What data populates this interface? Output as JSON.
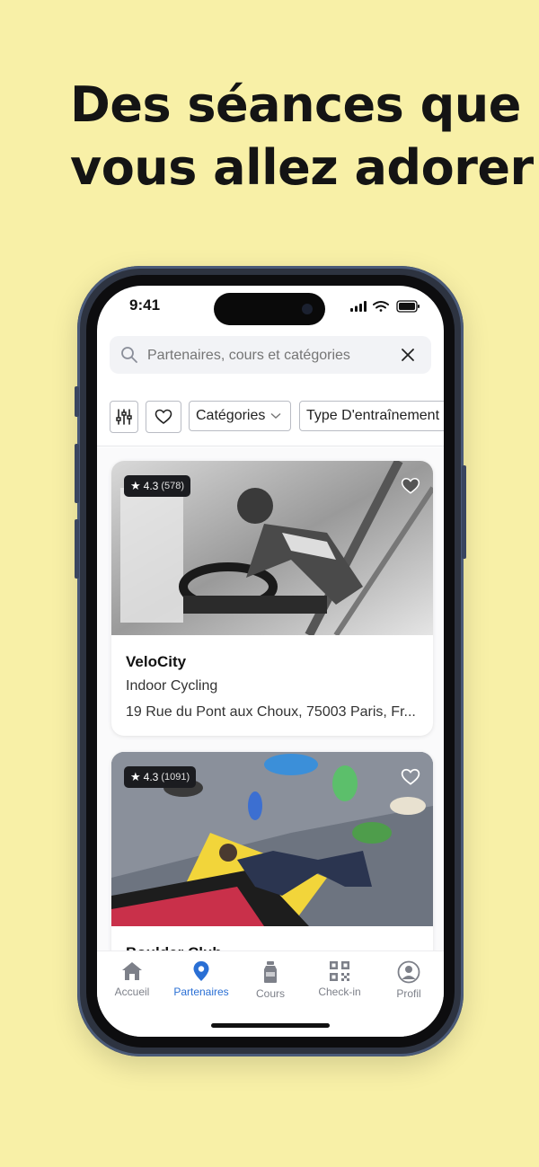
{
  "headline": {
    "line1": "Des séances que",
    "line2": "vous allez adorer"
  },
  "status": {
    "time": "9:41"
  },
  "search": {
    "placeholder": "Partenaires, cours et catégories"
  },
  "filters": {
    "categories": "Catégories",
    "training_type": "Type D'entraînement"
  },
  "cards": [
    {
      "rating": "4.3",
      "count": "(578)",
      "title": "VeloCity",
      "subtitle": "Indoor Cycling",
      "address": "19 Rue du Pont aux Choux, 75003 Paris, Fr..."
    },
    {
      "rating": "4.3",
      "count": "(1091)",
      "title": "Boulder Club"
    }
  ],
  "tabs": [
    {
      "label": "Accueil",
      "icon": "home-icon"
    },
    {
      "label": "Partenaires",
      "icon": "map-pin-icon",
      "active": true
    },
    {
      "label": "Cours",
      "icon": "bottle-icon"
    },
    {
      "label": "Check-in",
      "icon": "qr-code-icon"
    },
    {
      "label": "Profil",
      "icon": "profile-icon"
    }
  ],
  "colors": {
    "background": "#F8F0A7",
    "accent": "#2A6FD4",
    "phone_frame": "#2D3340"
  }
}
